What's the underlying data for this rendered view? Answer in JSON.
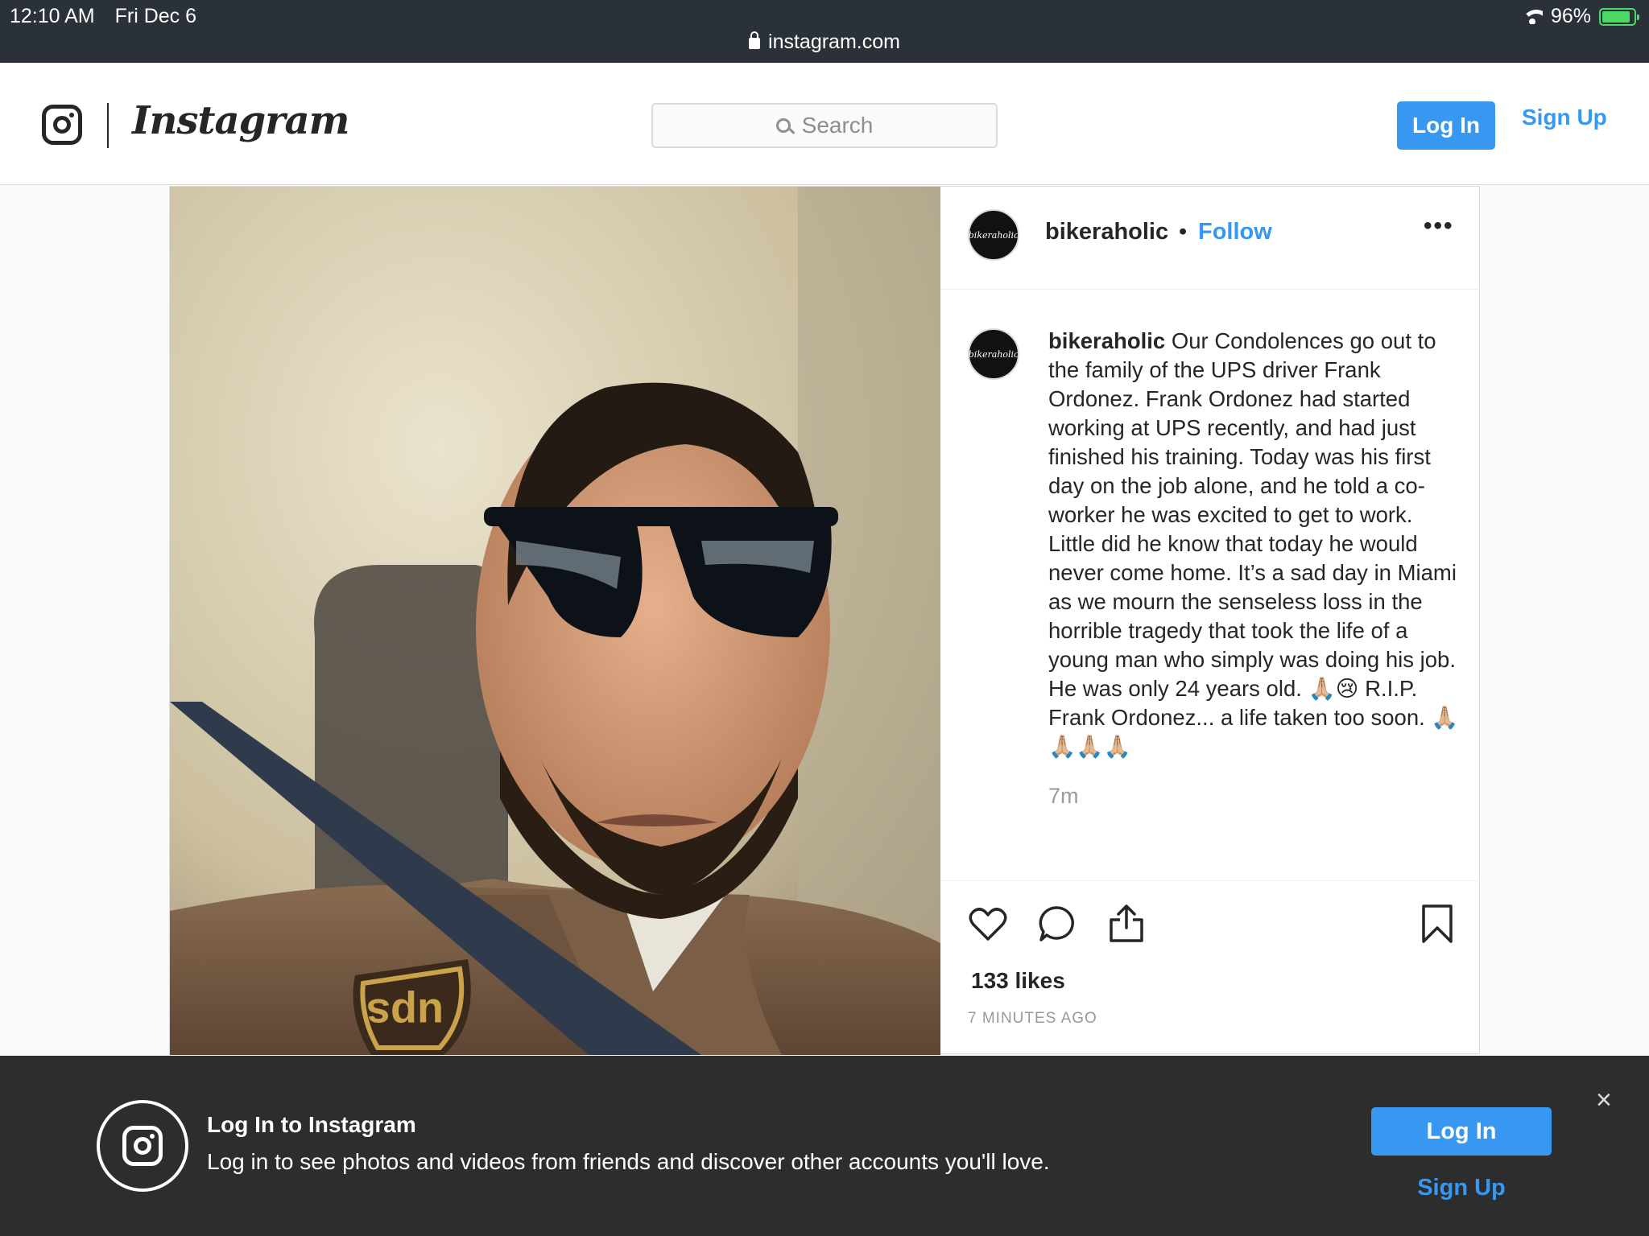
{
  "status_bar": {
    "time": "12:10 AM",
    "date": "Fri Dec 6",
    "url": "instagram.com",
    "battery": "96%",
    "battery_level": 0.96
  },
  "header": {
    "wordmark": "Instagram",
    "search_placeholder": "Search",
    "login_label": "Log In",
    "signup_label": "Sign Up"
  },
  "post": {
    "username": "bikeraholic",
    "avatar_text": "bikeraholic",
    "dot": "•",
    "follow_label": "Follow",
    "more": "•••",
    "caption_user": "bikeraholic",
    "caption_text": "Our Condolences go out to the family of the UPS driver Frank Ordonez. Frank Ordonez had started working at UPS recently, and had just finished his training. Today was his first day on the job alone, and he told a co-worker he was excited to get to work. Little did he know that today he would never come home. It’s a sad day in Miami as we mourn the senseless loss in the horrible tragedy that took the life of a young man who simply was doing his job. He was only 24 years old. 🙏🏼😢 R.I.P. Frank Ordonez... a life taken too soon. 🙏🏼🙏🏼🙏🏼🙏🏼",
    "time_ago": "7m",
    "likes": "133 likes",
    "timestamp": "7 MINUTES AGO",
    "photo_logo_text": "ups",
    "icons": [
      "heart-icon",
      "comment-icon",
      "share-icon",
      "bookmark-icon"
    ]
  },
  "login_banner": {
    "title": "Log In to Instagram",
    "subtitle": "Log in to see photos and videos from friends and discover other accounts you'll love.",
    "login_label": "Log In",
    "signup_label": "Sign Up",
    "close": "×"
  },
  "colors": {
    "accent": "#3897f0",
    "status_bar": "#2b3138",
    "banner": "#262626"
  }
}
